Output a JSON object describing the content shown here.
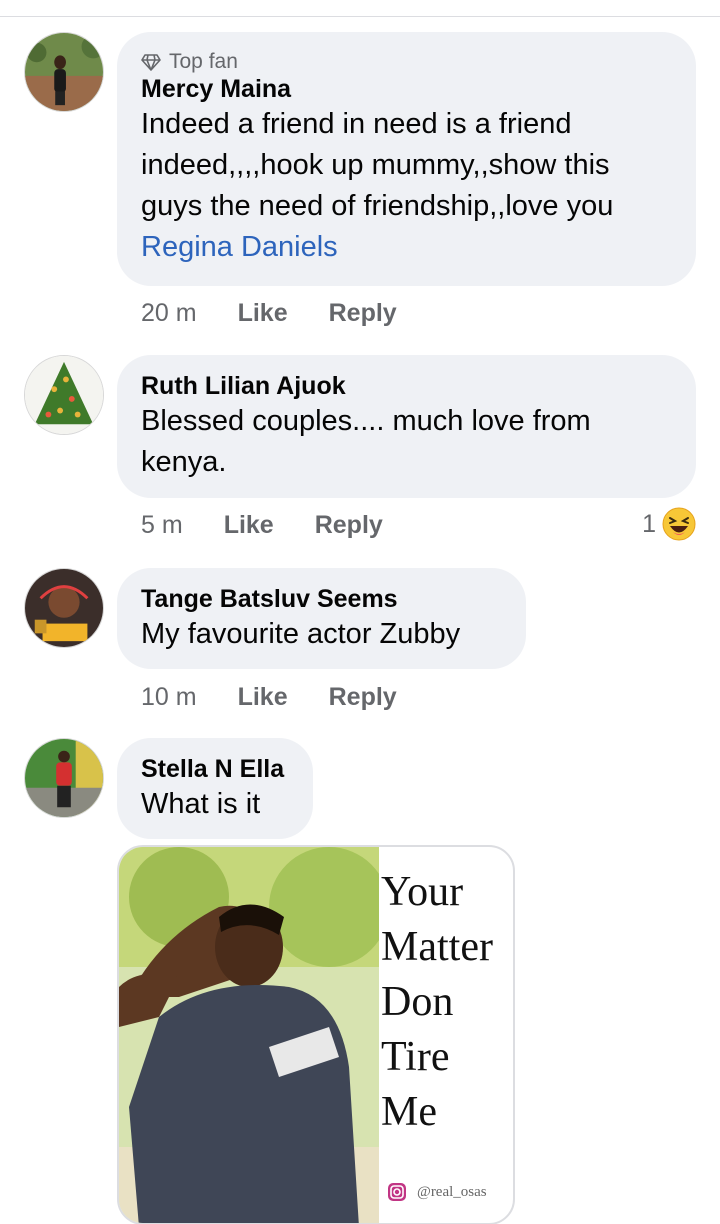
{
  "comments": [
    {
      "badge": "Top fan",
      "name": "Mercy Maina",
      "text_lines": [
        "Indeed a friend in need is a friend",
        "indeed,,,,hook up mummy,,show this",
        "guys the need of friendship,,love you"
      ],
      "mention": "Regina Daniels",
      "time": "20 m",
      "like": "Like",
      "reply": "Reply"
    },
    {
      "name": "Ruth Lilian Ajuok",
      "text_lines": [
        "Blessed couples....  much love from",
        "kenya."
      ],
      "time": "5 m",
      "like": "Like",
      "reply": "Reply",
      "reaction_count": "1"
    },
    {
      "name": "Tange Batsluv Seems",
      "text_lines": [
        "My favourite actor Zubby"
      ],
      "time": "10 m",
      "like": "Like",
      "reply": "Reply"
    },
    {
      "name": "Stella N Ella",
      "text_lines": [
        "What is it"
      ],
      "attachment": {
        "lines": [
          "Your",
          "Matter",
          "Don",
          "Tire",
          "Me"
        ],
        "handle": "@real_osas"
      }
    }
  ],
  "icons": {
    "badge": "diamond-icon",
    "reaction": "laughing-emoji-icon",
    "handle": "instagram-icon"
  },
  "colors": {
    "bubble": "#eff1f5",
    "mention": "#2d64bc",
    "meta": "#65676b"
  }
}
